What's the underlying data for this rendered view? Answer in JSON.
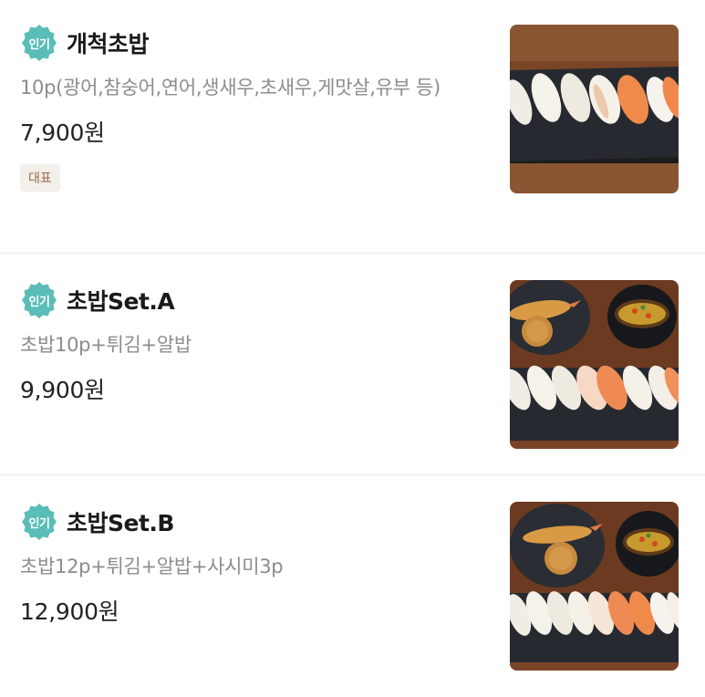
{
  "menu": {
    "items": [
      {
        "badge": "인기",
        "name": "개척초밥",
        "description": "10p(광어,참숭어,연어,생새우,초새우,게맛살,유부 등)",
        "price": "7,900원",
        "tag": "대표",
        "image": "sushi-platter-photo"
      },
      {
        "badge": "인기",
        "name": "초밥Set.A",
        "description": "초밥10p+튀김+알밥",
        "price": "9,900원",
        "image": "sushi-set-photo"
      },
      {
        "badge": "인기",
        "name": "초밥Set.B",
        "description": "초밥12p+튀김+알밥+사시미3p",
        "price": "12,900원",
        "image": "sushi-set-photo"
      }
    ]
  },
  "colors": {
    "badge": "#5bbdb8",
    "tag_bg": "#f3efea",
    "tag_text": "#9a6a4a",
    "description": "#8c8c8c"
  }
}
